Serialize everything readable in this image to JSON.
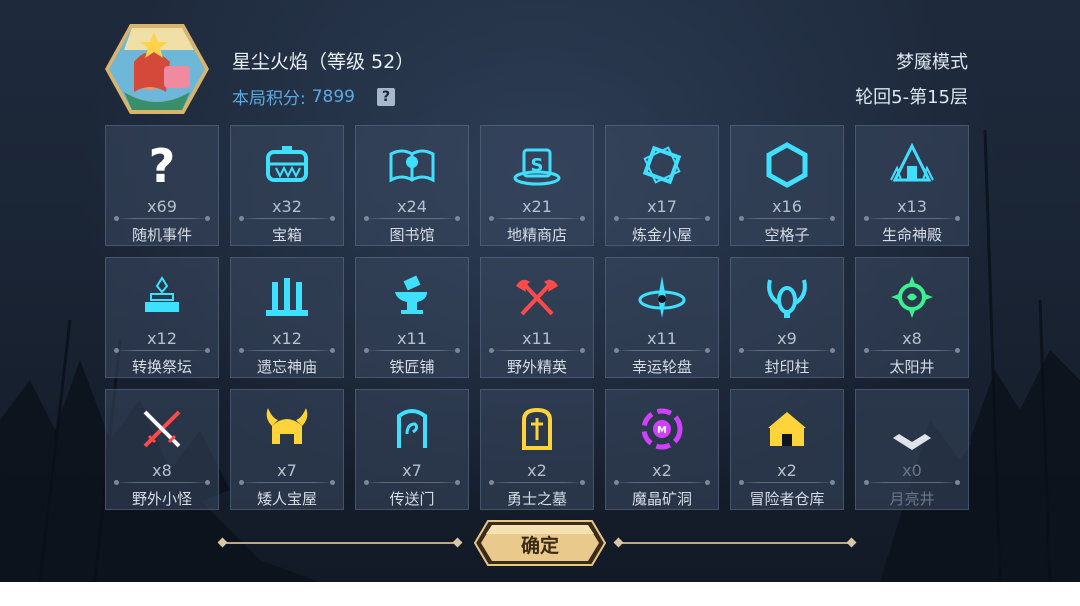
{
  "header": {
    "player_name": "星尘火焰（等级 52）",
    "score_label": "本局积分:",
    "score_value": "7899",
    "help_icon": "?",
    "mode": "梦魇模式",
    "cycle": "轮回5-第15层"
  },
  "events": [
    {
      "label": "随机事件",
      "count": "x69",
      "icon": "question-icon",
      "color": "#ffffff"
    },
    {
      "label": "宝箱",
      "count": "x32",
      "icon": "chest-icon",
      "color": "#3fe0ff"
    },
    {
      "label": "图书馆",
      "count": "x24",
      "icon": "book-icon",
      "color": "#3fe0ff"
    },
    {
      "label": "地精商店",
      "count": "x21",
      "icon": "shop-icon",
      "color": "#3fe0ff"
    },
    {
      "label": "炼金小屋",
      "count": "x17",
      "icon": "alchemy-icon",
      "color": "#3fe0ff"
    },
    {
      "label": "空格子",
      "count": "x16",
      "icon": "hexagon-icon",
      "color": "#3fe0ff"
    },
    {
      "label": "生命神殿",
      "count": "x13",
      "icon": "temple-icon",
      "color": "#3fe0ff"
    },
    {
      "label": "转换祭坛",
      "count": "x12",
      "icon": "altar-icon",
      "color": "#3fe0ff"
    },
    {
      "label": "遗忘神庙",
      "count": "x12",
      "icon": "shrine-icon",
      "color": "#3fe0ff"
    },
    {
      "label": "铁匠铺",
      "count": "x11",
      "icon": "anvil-icon",
      "color": "#3fe0ff"
    },
    {
      "label": "野外精英",
      "count": "x11",
      "icon": "crossed-axes-icon",
      "color": "#ff4a4a"
    },
    {
      "label": "幸运轮盘",
      "count": "x11",
      "icon": "wheel-icon",
      "color": "#3fe0ff"
    },
    {
      "label": "封印柱",
      "count": "x9",
      "icon": "seal-pillar-icon",
      "color": "#3fe0ff"
    },
    {
      "label": "太阳井",
      "count": "x8",
      "icon": "sun-well-icon",
      "color": "#3cf090"
    },
    {
      "label": "野外小怪",
      "count": "x8",
      "icon": "crossed-swords-icon",
      "color": "#ff4a4a"
    },
    {
      "label": "矮人宝屋",
      "count": "x7",
      "icon": "dwarf-helmet-icon",
      "color": "#ffd43a"
    },
    {
      "label": "传送门",
      "count": "x7",
      "icon": "portal-icon",
      "color": "#3fe0ff"
    },
    {
      "label": "勇士之墓",
      "count": "x2",
      "icon": "tomb-icon",
      "color": "#ffd43a"
    },
    {
      "label": "魔晶矿洞",
      "count": "x2",
      "icon": "crystal-mine-icon",
      "color": "#d040ff"
    },
    {
      "label": "冒险者仓库",
      "count": "x2",
      "icon": "warehouse-icon",
      "color": "#ffd43a"
    },
    {
      "label": "月亮井",
      "count": "x0",
      "icon": "moon-well-icon",
      "color": "#e0e4ea"
    }
  ],
  "confirm_label": "确定"
}
